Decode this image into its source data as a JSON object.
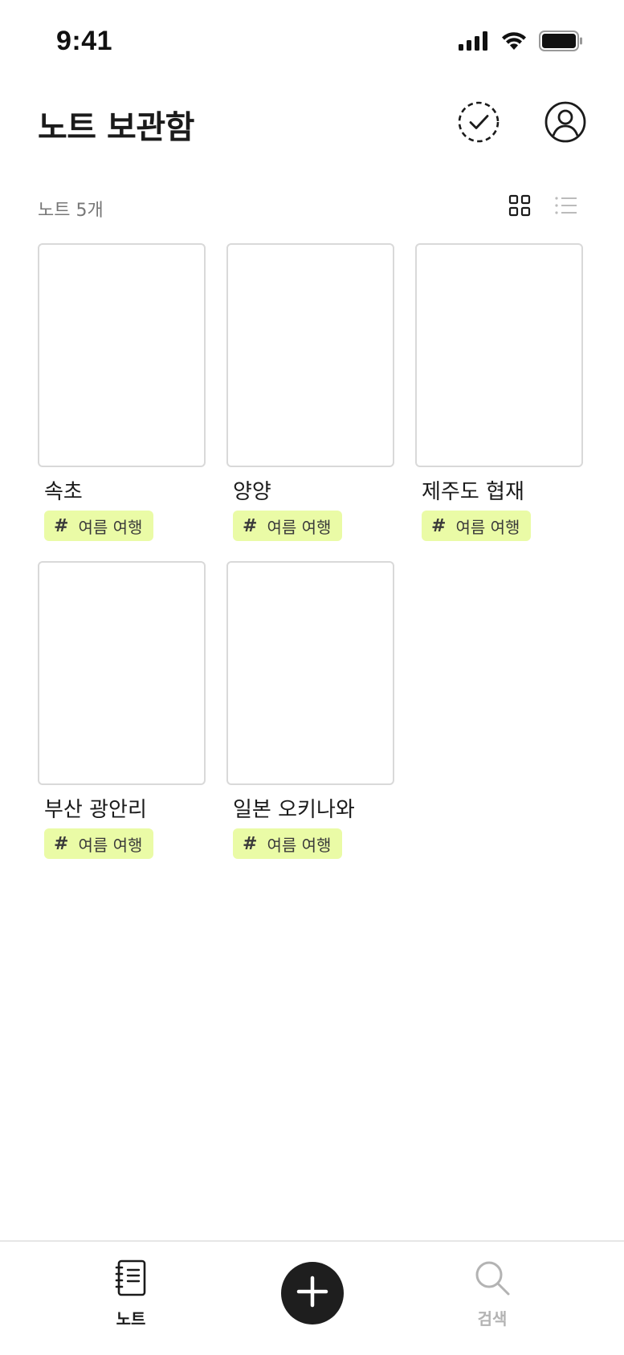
{
  "status_bar": {
    "time": "9:41",
    "icons": [
      "cellular-signal-icon",
      "wifi-icon",
      "battery-icon"
    ]
  },
  "header": {
    "title": "노트 보관함",
    "actions": [
      {
        "name": "select-icon",
        "label": ""
      },
      {
        "name": "profile-icon",
        "label": ""
      }
    ]
  },
  "toolbar": {
    "note_count": "노트 5개",
    "view_modes": [
      "grid",
      "list"
    ],
    "active_view": "grid"
  },
  "notes": [
    {
      "title": "속초",
      "tag": "여름 여행"
    },
    {
      "title": "양양",
      "tag": "여름 여행"
    },
    {
      "title": "제주도 협재",
      "tag": "여름 여행"
    },
    {
      "title": "부산 광안리",
      "tag": "여름 여행"
    },
    {
      "title": "일본 오키나와",
      "tag": "여름 여행"
    }
  ],
  "tag_symbol": "#",
  "tab_bar": {
    "notes_label": "노트",
    "search_label": "검색",
    "active_tab": "notes"
  },
  "colors": {
    "tag_background": "#eafba6",
    "fab_background": "#1e1e1e",
    "inactive_tab": "#b3b3b3"
  }
}
